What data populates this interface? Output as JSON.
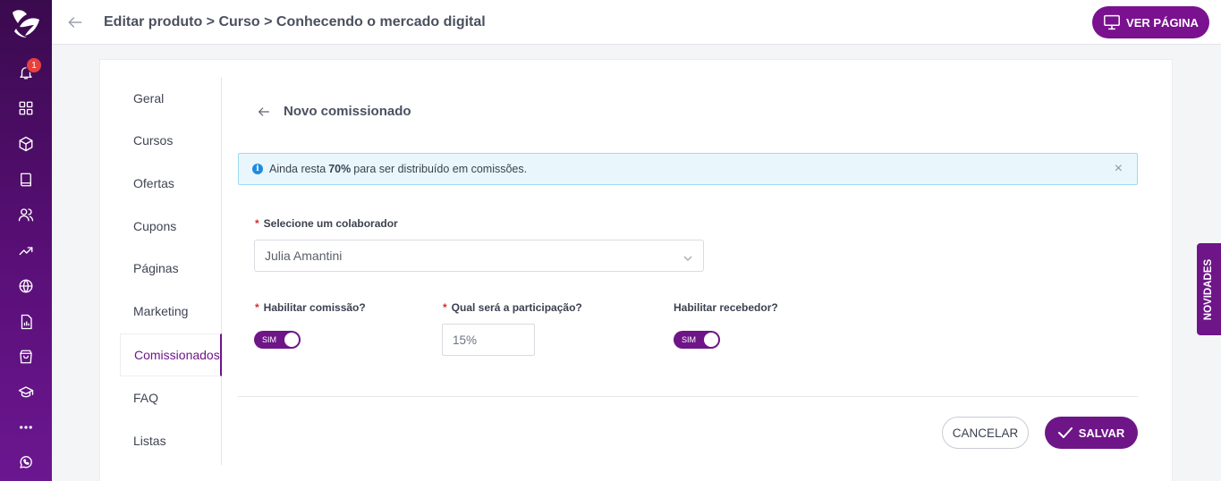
{
  "topbar": {
    "title": "Editar produto > Curso > Conhecendo o mercado digital",
    "view_page_label": "VER PÁGINA"
  },
  "rail": {
    "notification_count": "1",
    "icons": [
      "bell-icon",
      "grid-icon",
      "box-icon",
      "book-icon",
      "users-icon",
      "trending-icon",
      "globe-icon",
      "report-icon",
      "bag-icon",
      "graduation-icon",
      "more-icon",
      "whatsapp-icon"
    ]
  },
  "subnav": {
    "items": [
      {
        "label": "Geral"
      },
      {
        "label": "Cursos"
      },
      {
        "label": "Ofertas"
      },
      {
        "label": "Cupons"
      },
      {
        "label": "Páginas"
      },
      {
        "label": "Marketing"
      },
      {
        "label": "Comissionados"
      },
      {
        "label": "FAQ"
      },
      {
        "label": "Listas"
      }
    ],
    "active": "Comissionados"
  },
  "section": {
    "title": "Novo comissionado"
  },
  "alert": {
    "prefix": "Ainda resta",
    "highlight": "70%",
    "suffix": "para ser distribuído em comissões.",
    "close": "×",
    "info": "i"
  },
  "form": {
    "collaborator_label": "Selecione um colaborador",
    "collaborator_value": "Julia Amantini",
    "enable_commission_label": "Habilitar comissão?",
    "enable_commission_value": "SIM",
    "participation_label": "Qual será a participação?",
    "participation_value": "15%",
    "enable_receiver_label": "Habilitar recebedor?",
    "enable_receiver_value": "SIM",
    "required_mark": "*"
  },
  "actions": {
    "cancel_label": "CANCELAR",
    "save_label": "SALVAR"
  },
  "side_tab": {
    "label": "NOVIDADES"
  },
  "colors": {
    "primary": "#6e1588",
    "alert_bg": "#e9f7fd",
    "alert_border": "#9fd9ef",
    "badge": "#e8413c"
  }
}
